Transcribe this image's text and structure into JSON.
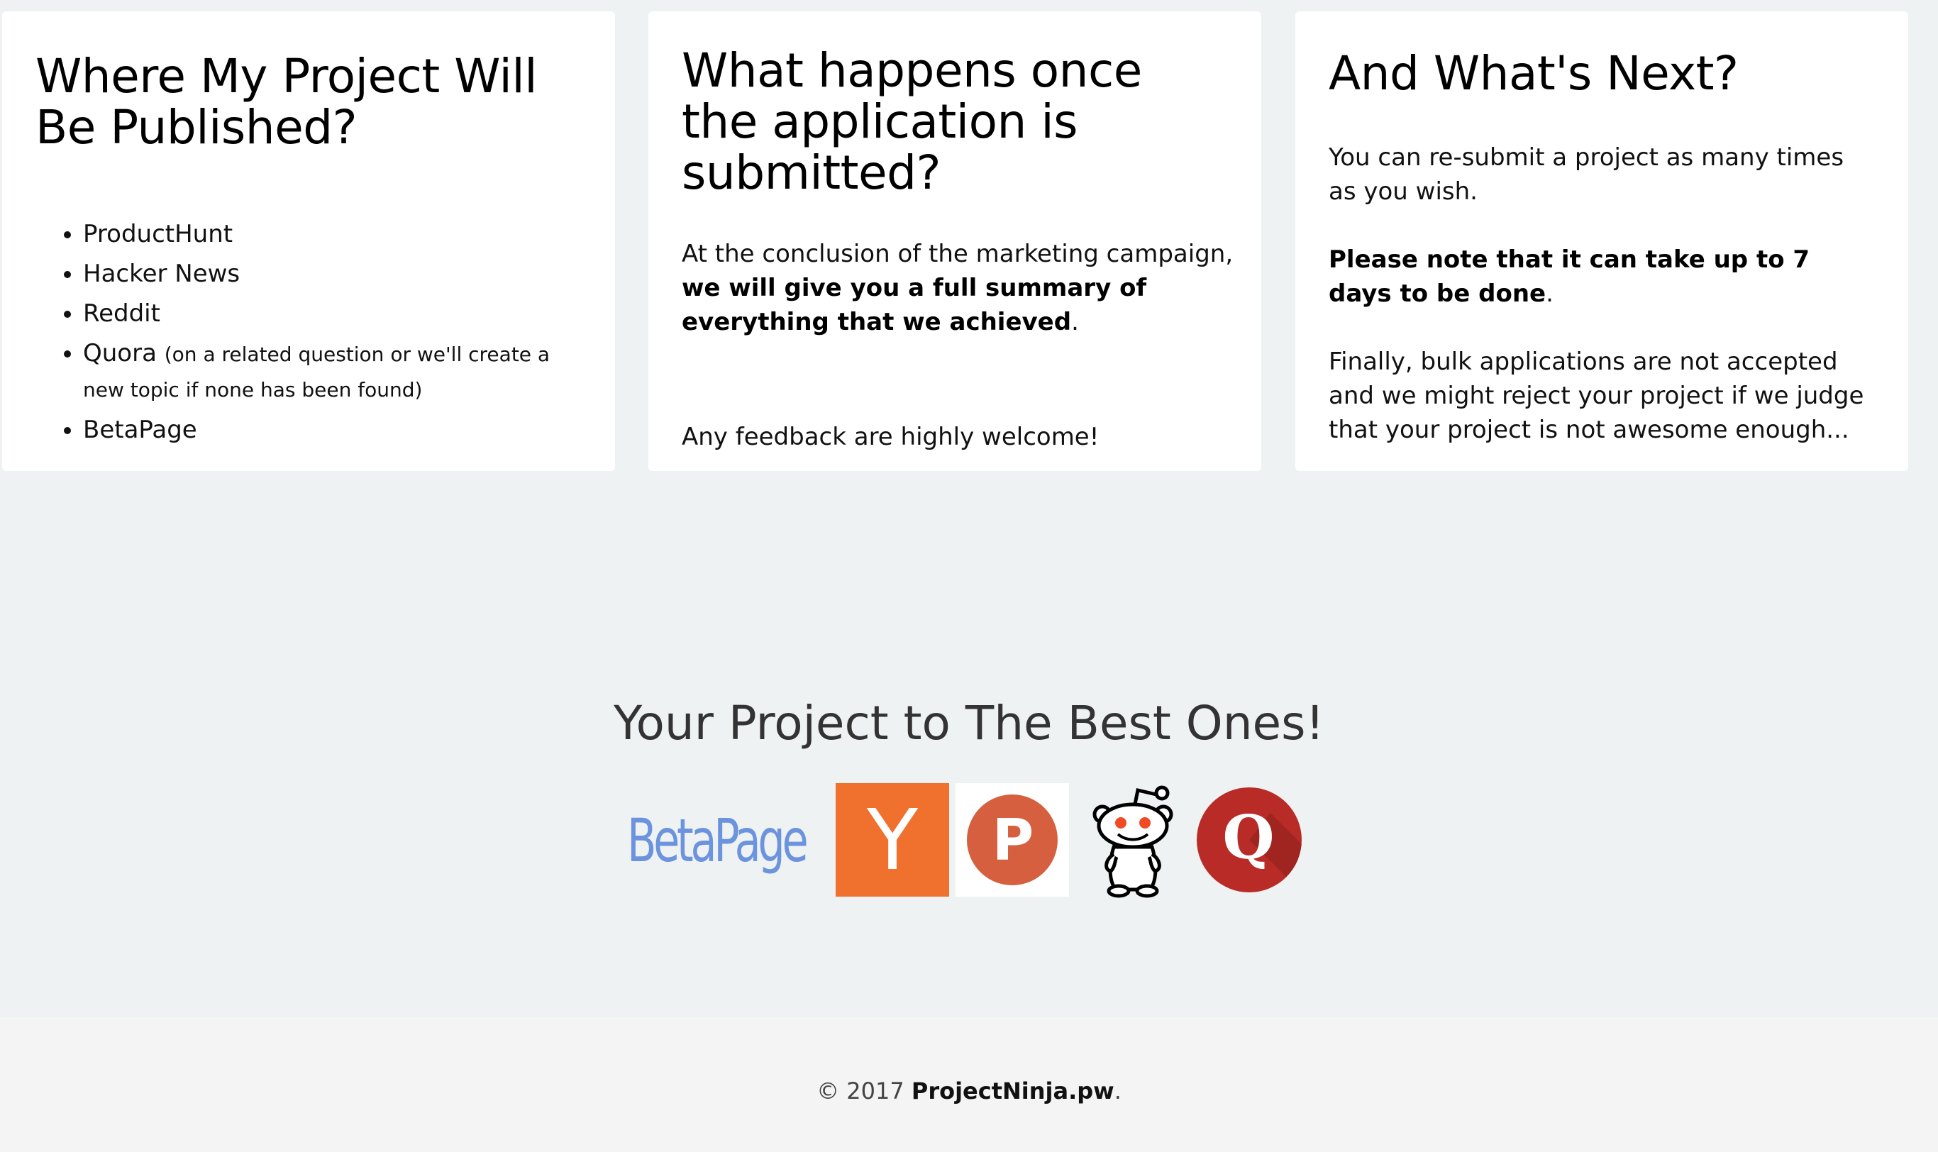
{
  "cards": {
    "published": {
      "title": "Where My Project Will Be Published?",
      "items": [
        {
          "label": "ProductHunt",
          "note": ""
        },
        {
          "label": "Hacker News",
          "note": ""
        },
        {
          "label": "Reddit",
          "note": ""
        },
        {
          "label": "Quora",
          "note": "(on a related question or we'll create a new topic if none has been found)"
        },
        {
          "label": "BetaPage",
          "note": ""
        }
      ]
    },
    "submitted": {
      "title": "What happens once the application is submitted?",
      "intro": "At the conclusion of the marketing campaign,",
      "bold": "we will give you a full summary of everything that we achieved",
      "period": ".",
      "feedback": "Any feedback are highly welcome!"
    },
    "next": {
      "title": "And What's Next?",
      "para1": "You can re-submit a project as many times as you wish.",
      "para2_bold": "Please note that it can take up to 7 days to be done",
      "para2_end": ".",
      "para3": "Finally, bulk applications are not accepted and we might reject your project if we judge that your project is not awesome enough..."
    }
  },
  "tagline": "Your Project to The Best Ones!",
  "logos": {
    "betapage": "BetaPage",
    "hackernews": "Y",
    "producthunt": "P",
    "quora": "Q"
  },
  "footer": {
    "prefix": "© 2017 ",
    "brand": "ProjectNinja.pw",
    "suffix": "."
  }
}
